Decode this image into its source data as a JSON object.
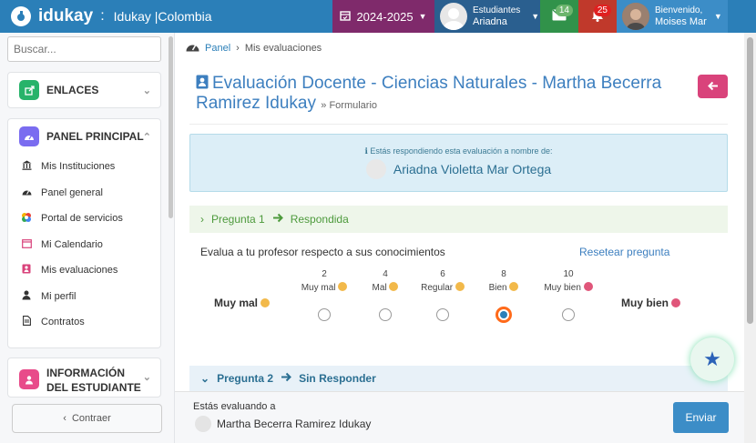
{
  "topbar": {
    "brand": "idukay",
    "separator": ":",
    "institution": "Idukay |Colombia",
    "year": "2024-2025",
    "students_label": "Estudiantes",
    "student_name": "Ariadna",
    "messages_count": "14",
    "notifications_count": "25",
    "welcome": "Bienvenido,",
    "user_name": "Moises Mar"
  },
  "sidebar": {
    "search_placeholder": "Buscar...",
    "enlaces": "ENLACES",
    "panel_principal": "PANEL PRINCIPAL",
    "items": [
      {
        "label": "Mis Instituciones",
        "icon": "institution-icon"
      },
      {
        "label": "Panel general",
        "icon": "dashboard-icon"
      },
      {
        "label": "Portal de servicios",
        "icon": "services-icon"
      },
      {
        "label": "Mi Calendario",
        "icon": "calendar-icon"
      },
      {
        "label": "Mis evaluaciones",
        "icon": "evaluation-icon"
      },
      {
        "label": "Mi perfil",
        "icon": "user-icon"
      },
      {
        "label": "Contratos",
        "icon": "document-icon"
      }
    ],
    "info_estudiante": "INFORMACIÓN DEL ESTUDIANTE",
    "collapse": "Contraer"
  },
  "breadcrumb": {
    "panel": "Panel",
    "current": "Mis evaluaciones"
  },
  "page": {
    "title": "Evaluación Docente - Ciencias Naturales - Martha Becerra Ramirez Idukay",
    "subtitle": "» Formulario"
  },
  "info": {
    "text": "Estás respondiendo esta evaluación a nombre de:",
    "name": "Ariadna Violetta Mar Ortega"
  },
  "question1": {
    "header": "Pregunta 1",
    "status": "Respondida",
    "text": "Evalua a tu profesor respecto a sus conocimientos",
    "reset": "Resetear pregunta",
    "scale_left": "Muy mal",
    "scale_right": "Muy bien",
    "options": [
      {
        "value": "2",
        "label": "Muy mal",
        "selected": false,
        "emoji_color": "#f2b94a"
      },
      {
        "value": "4",
        "label": "Mal",
        "selected": false,
        "emoji_color": "#f2b94a"
      },
      {
        "value": "6",
        "label": "Regular",
        "selected": false,
        "emoji_color": "#f2b94a"
      },
      {
        "value": "8",
        "label": "Bien",
        "selected": true,
        "emoji_color": "#f2b94a"
      },
      {
        "value": "10",
        "label": "Muy bien",
        "selected": false,
        "emoji_color": "#e0567a"
      }
    ]
  },
  "question2": {
    "header": "Pregunta 2",
    "status": "Sin Responder"
  },
  "footer": {
    "evaluating": "Estás evaluando a",
    "teacher": "Martha Becerra Ramirez Idukay",
    "send": "Enviar"
  },
  "colors": {
    "primary": "#2b7fb8",
    "year_bg": "#7f2a6b",
    "messages_bg": "#31924a",
    "notifications_bg": "#c0392b",
    "back_button": "#d9437b",
    "answered": "#4d9a3c"
  }
}
